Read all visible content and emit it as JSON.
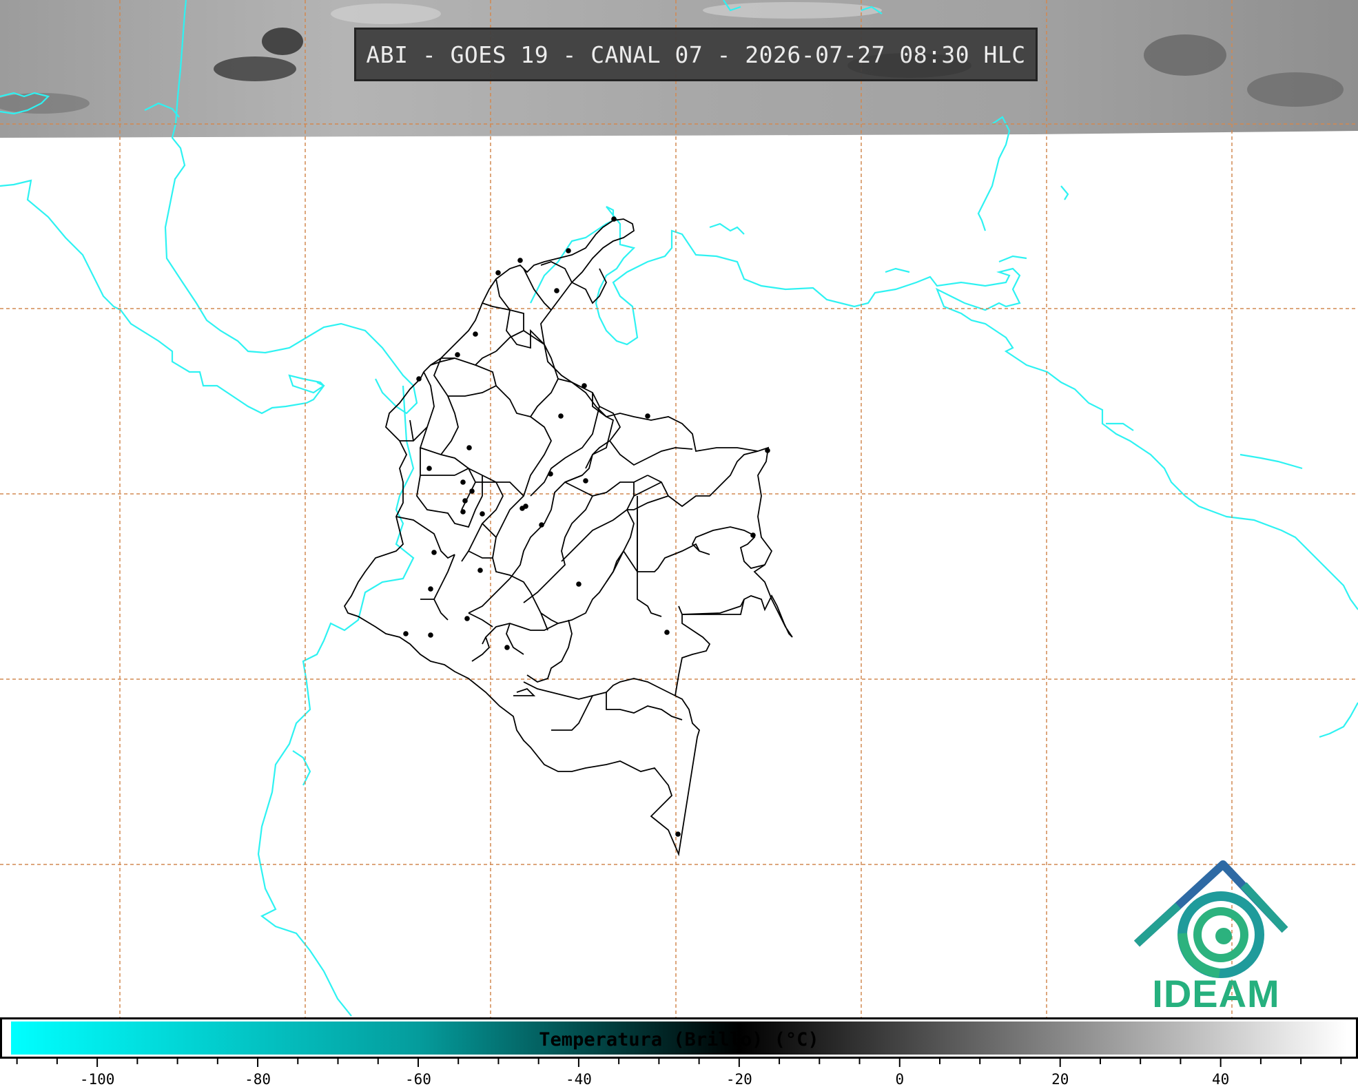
{
  "map": {
    "title": "ABI - GOES 19 - CANAL 07 - 2026-07-27 08:30 HLC",
    "satellite_strip": "grayscale-infrared-imagery",
    "coastline_color": "#2ef2f2",
    "gridline_color": "#d28850",
    "border_color": "#000000",
    "city_marker_color": "#000000"
  },
  "logo": {
    "name": "IDEAM",
    "icon": "ideam-logo-icon",
    "colors": {
      "blue": "#2e5fa0",
      "teal": "#1f9b9b",
      "green": "#26b07e"
    }
  },
  "colorbar": {
    "label": "Temperatura (Brillo) (°C)",
    "tick_labels": [
      "-100",
      "-80",
      "-60",
      "-40",
      "-20",
      "0",
      "20",
      "40"
    ],
    "tick_values": [
      -100,
      -80,
      -60,
      -40,
      -20,
      0,
      20,
      40
    ],
    "range": [
      -111,
      56
    ],
    "gradient": [
      {
        "value": -111,
        "color": "#00ffff"
      },
      {
        "value": -60,
        "color": "#059c9c"
      },
      {
        "value": -20,
        "color": "#000000"
      },
      {
        "value": 56,
        "color": "#ffffff"
      }
    ]
  }
}
